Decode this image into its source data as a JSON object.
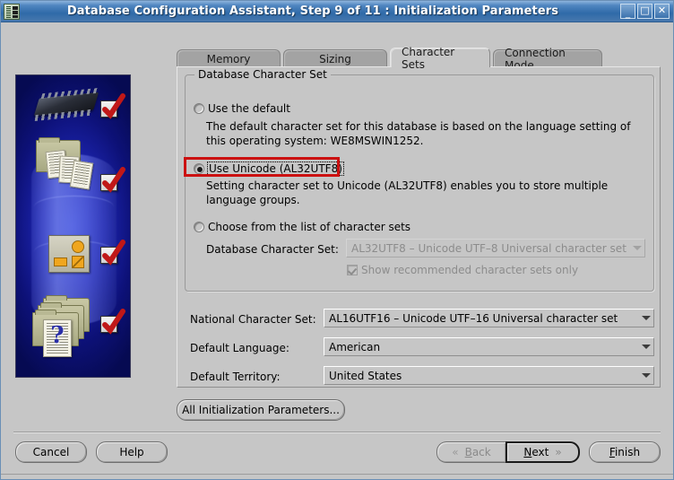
{
  "window": {
    "title": "Database Configuration Assistant, Step 9 of 11 : Initialization Parameters",
    "icon": "database-assistant-icon",
    "minimize_label": "_",
    "maximize_label": "□",
    "close_label": "✕"
  },
  "sidebar": {
    "name": "dbca-illustration",
    "checkmarks": 4
  },
  "tabs": [
    {
      "label": "Memory",
      "active": false,
      "name": "tab-memory"
    },
    {
      "label": "Sizing",
      "active": false,
      "name": "tab-sizing"
    },
    {
      "label": "Character Sets",
      "active": true,
      "name": "tab-character-sets"
    },
    {
      "label": "Connection Mode",
      "active": false,
      "name": "tab-connection-mode"
    }
  ],
  "group": {
    "title": "Database Character Set",
    "options": [
      {
        "label": "Use the default",
        "selected": false,
        "description": "The default character set for this database is based on the language setting of this operating system: WE8MSWIN1252."
      },
      {
        "label": "Use Unicode (AL32UTF8)",
        "selected": true,
        "focused": true,
        "highlighted": true,
        "description": "Setting character set to Unicode (AL32UTF8) enables you to store multiple language groups."
      },
      {
        "label": "Choose from the list of character sets",
        "selected": false,
        "description": ""
      }
    ],
    "db_charset_label": "Database Character Set:",
    "db_charset_value": "AL32UTF8 – Unicode UTF–8 Universal character set",
    "db_charset_disabled": true,
    "show_recommended_label": "Show recommended character sets only",
    "show_recommended_checked": true,
    "show_recommended_disabled": true
  },
  "fields": [
    {
      "label": "National Character Set:",
      "value": "AL16UTF16 – Unicode UTF–16 Universal character set",
      "name": "national-character-set"
    },
    {
      "label": "Default Language:",
      "value": "American",
      "name": "default-language"
    },
    {
      "label": "Default Territory:",
      "value": "United States",
      "name": "default-territory"
    }
  ],
  "all_params_button": "All Initialization Parameters...",
  "footer": {
    "cancel": "Cancel",
    "help": "Help",
    "back": "Back",
    "back_mnemonic": "B",
    "back_rest": "ack",
    "next": "Next",
    "next_mnemonic": "N",
    "next_rest": "ext",
    "finish": "Finish",
    "finish_mnemonic": "F",
    "finish_rest": "inish",
    "back_chevron": "«",
    "next_chevron": "»",
    "back_disabled": true,
    "next_default": true
  },
  "colors": {
    "panel": "#c6c6c6",
    "title_blue": "#2f6aa8",
    "annotation_red": "#cc1111",
    "tab_inactive": "#a3a3a3",
    "disabled_text": "#8c8c8c"
  }
}
